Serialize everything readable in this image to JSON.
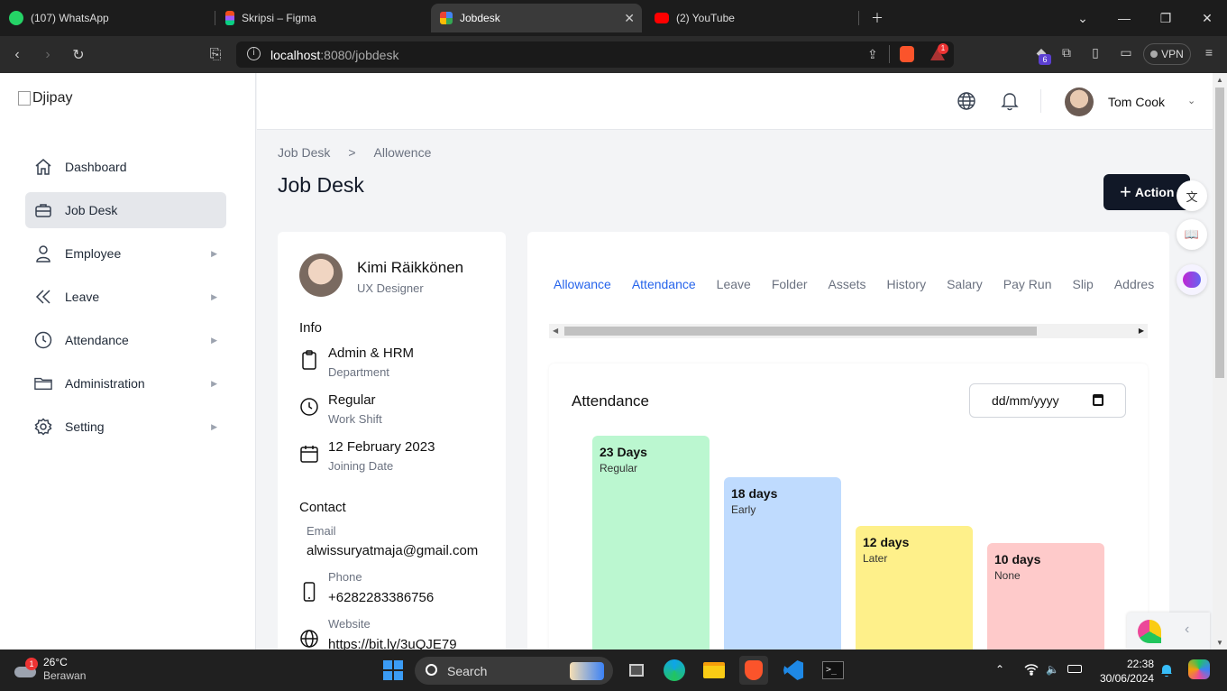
{
  "browser": {
    "tabs": [
      {
        "title": "(107) WhatsApp",
        "color": "#25d366"
      },
      {
        "title": "Skripsi – Figma",
        "color": "#f24e1e"
      },
      {
        "title": "Jobdesk",
        "color": "#4285f4"
      },
      {
        "title": "(2) YouTube",
        "color": "#ff0000"
      }
    ],
    "url_host": "localhost",
    "url_path": ":8080/jobdesk",
    "vpn_label": "VPN",
    "brave_badge": "1",
    "ext_badge": "6"
  },
  "app": {
    "logo_alt": "Djipay",
    "sidebar": {
      "items": [
        {
          "label": "Dashboard",
          "icon": "home-icon"
        },
        {
          "label": "Job Desk",
          "icon": "briefcase-icon",
          "active": true
        },
        {
          "label": "Employee",
          "icon": "user-icon"
        },
        {
          "label": "Leave",
          "icon": "double-chevron-left-icon"
        },
        {
          "label": "Attendance",
          "icon": "clock-icon"
        },
        {
          "label": "Administration",
          "icon": "folder-icon"
        },
        {
          "label": "Setting",
          "icon": "gear-icon"
        }
      ]
    },
    "header": {
      "user_name": "Tom Cook"
    },
    "breadcrumb": {
      "root": "Job Desk",
      "sep": ">",
      "current": "Allowence"
    },
    "page_title": "Job Desk",
    "action_label": "Action",
    "employee": {
      "name": "Kimi Räikkönen",
      "role": "UX Designer",
      "info_title": "Info",
      "department": {
        "value": "Admin & HRM",
        "label": "Department"
      },
      "shift": {
        "value": "Regular",
        "label": "Work Shift"
      },
      "joining": {
        "value": "12 February 2023",
        "label": "Joining Date"
      },
      "contact_title": "Contact",
      "email": {
        "label": "Email",
        "value": "alwissuryatmaja@gmail.com"
      },
      "phone": {
        "label": "Phone",
        "value": "+6282283386756"
      },
      "website": {
        "label": "Website",
        "value": "https://bit.ly/3uQJE79"
      }
    },
    "tabs": [
      "Allowance",
      "Attendance",
      "Leave",
      "Folder",
      "Assets",
      "History",
      "Salary",
      "Pay Run",
      "Slip",
      "Addres"
    ],
    "attendance": {
      "title": "Attendance",
      "date_placeholder": "dd/mm/yyyy",
      "bars": [
        {
          "value": "23 Days",
          "label": "Regular",
          "days": 23,
          "color": "#bbf7d0"
        },
        {
          "value": "18 days",
          "label": "Early",
          "days": 18,
          "color": "#bfdbfe"
        },
        {
          "value": "12 days",
          "label": "Later",
          "days": 12,
          "color": "#fef08a"
        },
        {
          "value": "10 days",
          "label": "None",
          "days": 10,
          "color": "#fecaca"
        }
      ]
    }
  },
  "taskbar": {
    "weather_temp": "26°C",
    "weather_desc": "Berawan",
    "weather_badge": "1",
    "search_label": "Search",
    "time": "22:38",
    "date": "30/06/2024"
  }
}
